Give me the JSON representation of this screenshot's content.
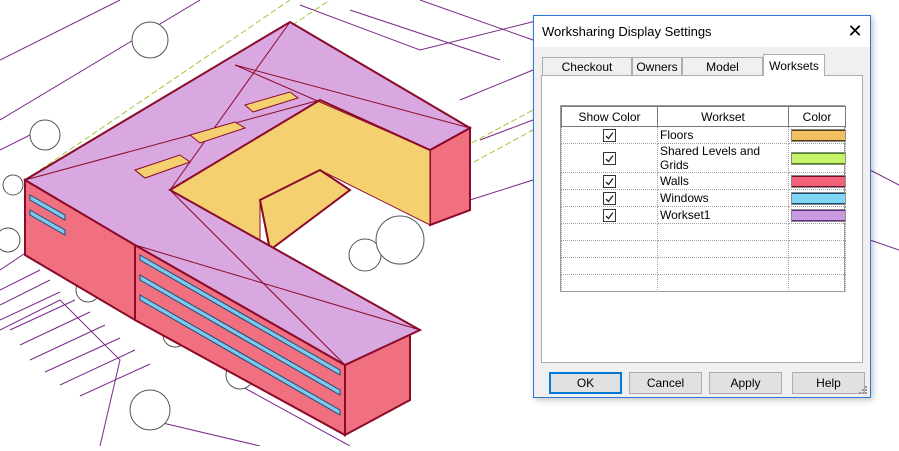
{
  "dialog": {
    "title": "Worksharing Display Settings",
    "close_glyph": "✕",
    "tabs": [
      {
        "label": "Checkout Status",
        "active": false
      },
      {
        "label": "Owners",
        "active": false
      },
      {
        "label": "Model Updates",
        "active": false
      },
      {
        "label": "Worksets",
        "active": true
      }
    ],
    "table": {
      "headers": [
        "Show Color",
        "Workset",
        "Color"
      ],
      "rows": [
        {
          "checked": true,
          "name": "Floors",
          "color": "#f0c060",
          "line": "#5a3a10"
        },
        {
          "checked": true,
          "name": "Shared Levels and Grids",
          "color": "#c6f26a",
          "line": "#4a8a10"
        },
        {
          "checked": true,
          "name": "Walls",
          "color": "#f2607a",
          "line": "#7a1030"
        },
        {
          "checked": true,
          "name": "Windows",
          "color": "#7fd6f5",
          "line": "#1a4a7a"
        },
        {
          "checked": true,
          "name": "Workset1",
          "color": "#c89ae0",
          "line": "#6a2a8a"
        }
      ]
    },
    "buttons": {
      "ok": "OK",
      "cancel": "Cancel",
      "apply": "Apply",
      "help": "Help"
    }
  },
  "colors": {
    "roof": "#d9a8e0",
    "outline": "#8b0a2a",
    "walls": "#f07080",
    "floors": "#f5d070",
    "windows": "#7fc8e8",
    "site_lines": "#7a2a8a",
    "grid_lines": "#c6e060"
  }
}
